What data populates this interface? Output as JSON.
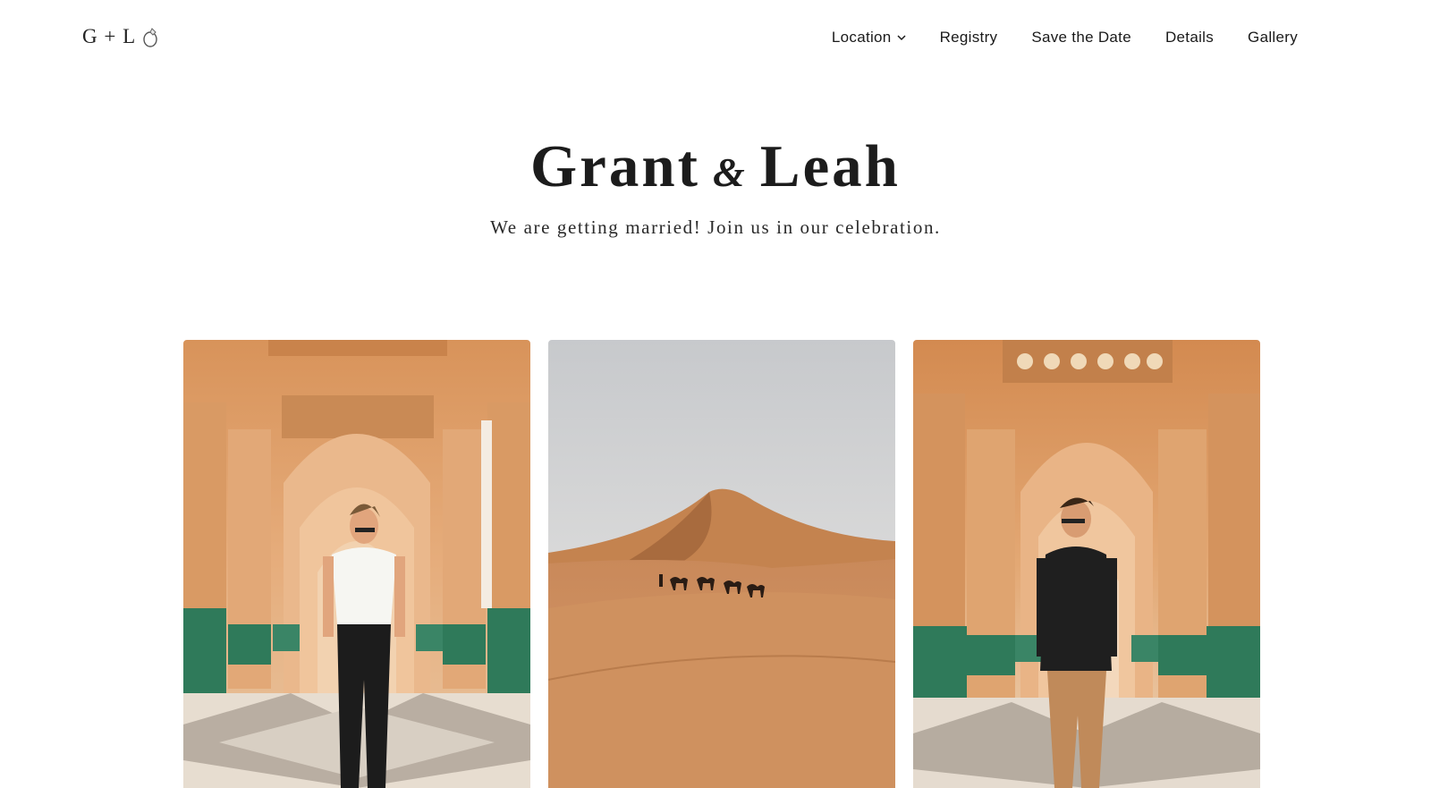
{
  "header": {
    "logo_text": "G + L",
    "logo_icon": "ring-icon",
    "nav": [
      {
        "label": "Location",
        "has_dropdown": true
      },
      {
        "label": "Registry"
      },
      {
        "label": "Save the Date"
      },
      {
        "label": "Details"
      },
      {
        "label": "Gallery"
      }
    ]
  },
  "hero": {
    "name_1": "Grant",
    "ampersand": "&",
    "name_2": "Leah",
    "subtitle": "We are getting married! Join us in our celebration."
  },
  "gallery": {
    "photos": [
      {
        "subject": "woman-in-archway-photo"
      },
      {
        "subject": "desert-camels-photo"
      },
      {
        "subject": "man-in-archway-photo"
      }
    ]
  },
  "colors": {
    "background": "#ffffff",
    "text": "#1a1a1a",
    "sandstone": "#d79a63",
    "tile_green": "#2f7a5a",
    "sand": "#c98a5a",
    "sky": "#dcdcdc"
  }
}
